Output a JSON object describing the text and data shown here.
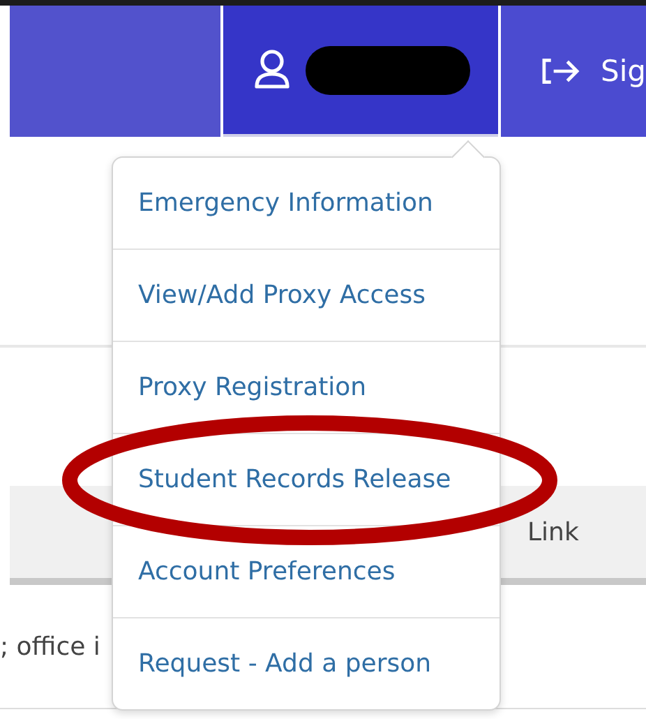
{
  "header": {
    "user_menu": {
      "expanded": true
    },
    "sign_out": {
      "label": "Sig"
    }
  },
  "page": {
    "table": {
      "columns": [
        {
          "label": "Link"
        }
      ],
      "rows": [
        {
          "text": "; office i"
        }
      ]
    }
  },
  "dropdown": {
    "items": [
      {
        "label": "Emergency Information",
        "highlighted": false
      },
      {
        "label": "View/Add Proxy Access",
        "highlighted": false
      },
      {
        "label": "Proxy Registration",
        "highlighted": false
      },
      {
        "label": "Student Records Release",
        "highlighted": true
      },
      {
        "label": "Account Preferences",
        "highlighted": false
      },
      {
        "label": "Request - Add a person",
        "highlighted": false
      }
    ]
  }
}
